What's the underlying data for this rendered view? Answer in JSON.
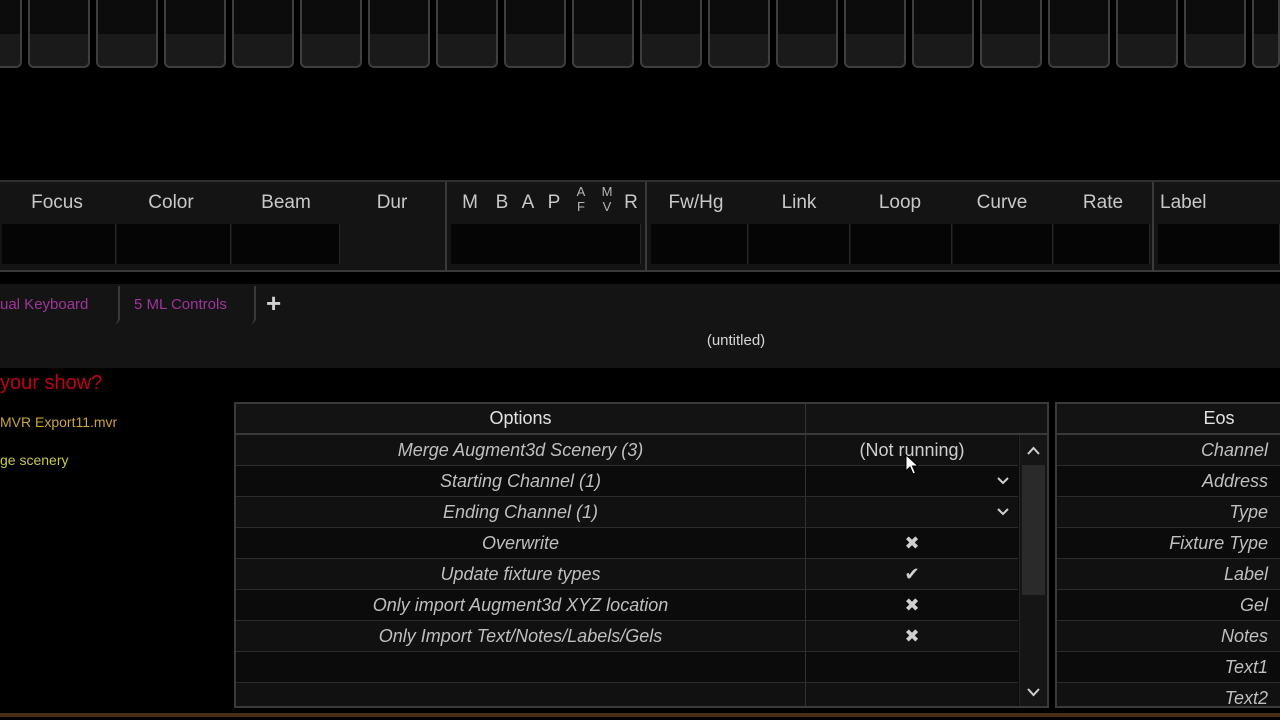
{
  "attribute_bar": {
    "focus": "Focus",
    "color": "Color",
    "beam": "Beam",
    "dur": "Dur",
    "flags": [
      "M",
      "B",
      "A",
      "P"
    ],
    "af_top": "A",
    "af_bottom": "F",
    "mv_top": "M",
    "mv_bottom": "V",
    "r": "R",
    "fw_hg": "Fw/Hg",
    "link": "Link",
    "loop": "Loop",
    "curve": "Curve",
    "rate": "Rate",
    "label": "Label"
  },
  "tabs": [
    {
      "label": "ual Keyboard"
    },
    {
      "label": "5 ML Controls"
    }
  ],
  "tab_add_label": "+",
  "document_title": "(untitled)",
  "wizard": {
    "prompt": "your show?",
    "file_name": "MVR Export11.mvr",
    "merge_label": "ge scenery"
  },
  "options_table": {
    "header": "Options",
    "rows": [
      {
        "name": "Merge Augment3d Scenery (3)",
        "value": "(Not running)"
      },
      {
        "name": "Starting Channel (1)",
        "value": ""
      },
      {
        "name": "Ending Channel (1)",
        "value": ""
      },
      {
        "name": "Overwrite",
        "mark": "✖"
      },
      {
        "name": "Update fixture types",
        "mark": "✔"
      },
      {
        "name": "Only import Augment3d XYZ location",
        "mark": "✖"
      },
      {
        "name": "Only Import Text/Notes/Labels/Gels",
        "mark": "✖"
      },
      {
        "name": ""
      },
      {
        "name": ""
      }
    ]
  },
  "eos_table": {
    "header": "Eos",
    "rows": [
      "Channel",
      "Address",
      "Type",
      "Fixture Type",
      "Label",
      "Gel",
      "Notes",
      "Text1",
      "Text2"
    ]
  },
  "icons": {
    "scroll_up": "chevron-up-icon",
    "scroll_down": "chevron-down-icon",
    "dropdown": "chevron-down-icon",
    "checked": "check-icon",
    "unchecked": "cross-icon"
  },
  "colors": {
    "prompt_text": "#c00014",
    "file_text": "#c9a53a",
    "merge_text": "#c8c846",
    "tab_text": "#a0349a"
  }
}
